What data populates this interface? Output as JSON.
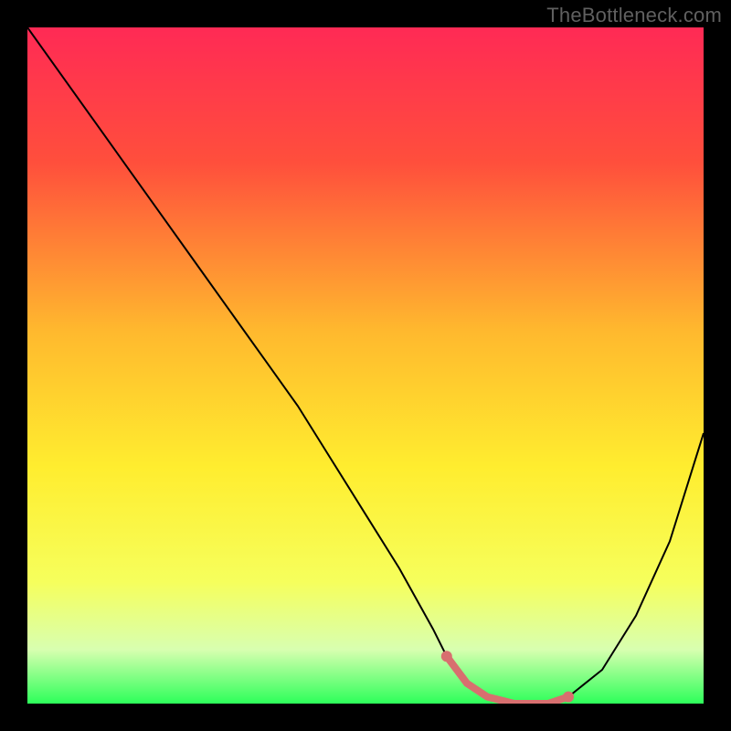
{
  "watermark": "TheBottleneck.com",
  "chart_data": {
    "type": "line",
    "title": "",
    "xlabel": "",
    "ylabel": "",
    "xlim": [
      0,
      100
    ],
    "ylim": [
      0,
      100
    ],
    "grid": false,
    "legend": false,
    "gradient": {
      "stops": [
        {
          "offset": 0.0,
          "color": "#ff2a55"
        },
        {
          "offset": 0.2,
          "color": "#ff4f3c"
        },
        {
          "offset": 0.45,
          "color": "#ffb92e"
        },
        {
          "offset": 0.65,
          "color": "#ffed2f"
        },
        {
          "offset": 0.82,
          "color": "#f6ff5c"
        },
        {
          "offset": 0.92,
          "color": "#d8ffb0"
        },
        {
          "offset": 1.0,
          "color": "#2dff5a"
        }
      ]
    },
    "series": [
      {
        "name": "curve",
        "x": [
          0,
          5,
          10,
          15,
          20,
          25,
          30,
          35,
          40,
          45,
          50,
          55,
          60,
          62,
          65,
          68,
          72,
          75,
          77,
          80,
          85,
          90,
          95,
          100
        ],
        "y": [
          100,
          93,
          86,
          79,
          72,
          65,
          58,
          51,
          44,
          36,
          28,
          20,
          11,
          7,
          3,
          1,
          0,
          0,
          0,
          1,
          5,
          13,
          24,
          40
        ],
        "color": "#000000",
        "width": 2
      },
      {
        "name": "highlight-segment",
        "x": [
          62,
          65,
          68,
          72,
          75,
          77,
          80
        ],
        "y": [
          7,
          3,
          1,
          0,
          0,
          0,
          1
        ],
        "color": "#d86f6f",
        "width": 8
      }
    ],
    "highlight_endpoints": {
      "color": "#d86f6f",
      "radius": 6,
      "points": [
        {
          "x": 62,
          "y": 7
        },
        {
          "x": 80,
          "y": 1
        }
      ]
    }
  }
}
